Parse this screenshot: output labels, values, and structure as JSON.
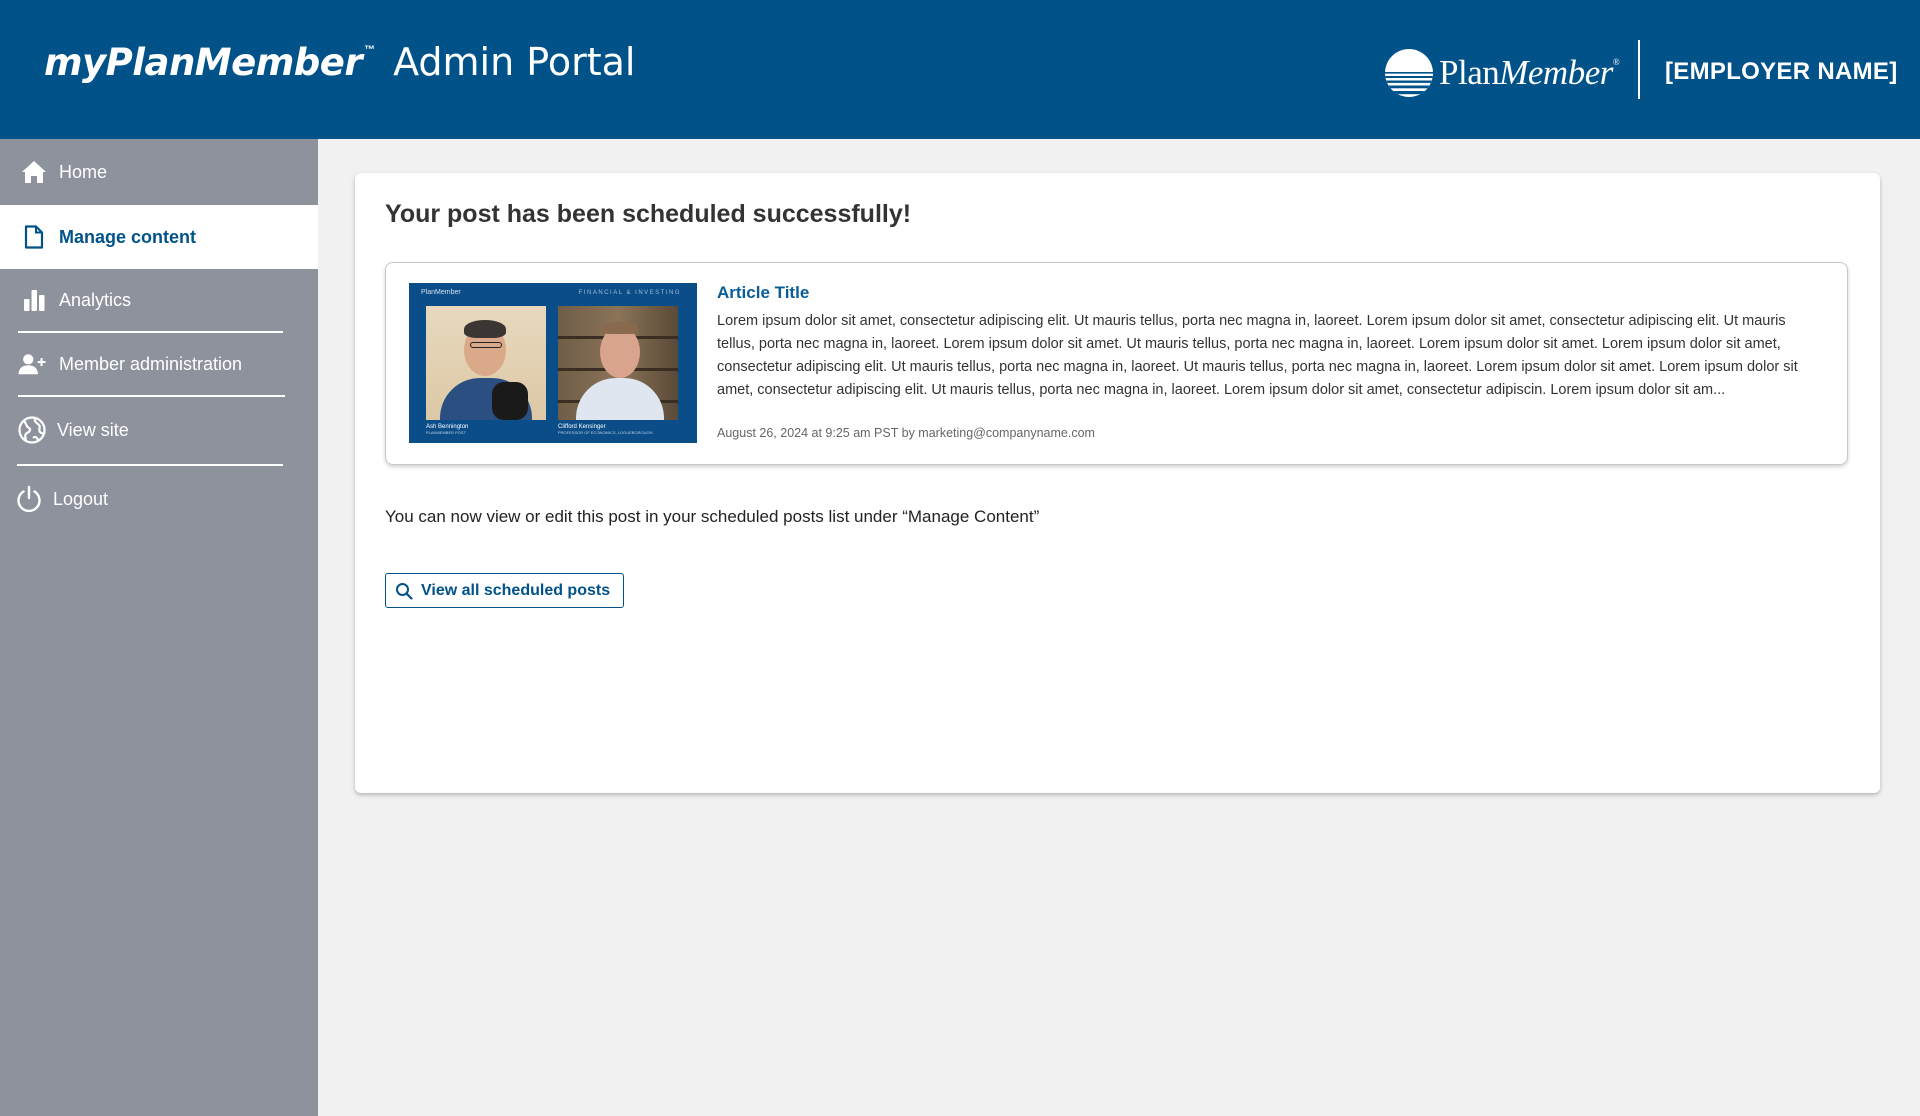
{
  "header": {
    "app_name": "myPlanMember",
    "trademark": "™",
    "portal_name": "Admin Portal",
    "logo_text_plan": "Plan",
    "logo_text_member": "Member",
    "logo_registered": "®",
    "employer_name": "[EMPLOYER NAME]"
  },
  "sidebar": {
    "items": [
      {
        "label": "Home",
        "icon": "home-icon"
      },
      {
        "label": "Manage content",
        "icon": "document-icon",
        "active": true
      },
      {
        "label": "Analytics",
        "icon": "bar-chart-icon"
      },
      {
        "label": "Member administration",
        "icon": "add-user-icon"
      },
      {
        "label": "View site",
        "icon": "globe-icon"
      },
      {
        "label": "Logout",
        "icon": "power-icon"
      }
    ]
  },
  "main": {
    "success_title": "Your post has been scheduled successfully!",
    "article": {
      "thumbnail_brand": "PlanMember",
      "thumbnail_tag": "FINANCIAL & INVESTING",
      "thumbnail_person_left": "Ash Bennington",
      "thumbnail_person_left_sub": "PLANMEMBER POST",
      "thumbnail_person_right": "Clifford Kensinger",
      "thumbnail_person_right_sub": "PROFESSOR OF ECONOMICS, LOGUEBOROUGH",
      "title": "Article Title",
      "body": "Lorem ipsum dolor sit amet, consectetur adipiscing elit. Ut mauris tellus, porta nec magna in, laoreet. Lorem ipsum dolor sit amet, consectetur adipiscing elit. Ut mauris tellus, porta nec magna in, laoreet. Lorem ipsum dolor sit amet. Ut mauris tellus, porta nec magna in, laoreet. Lorem ipsum dolor sit amet. Lorem ipsum dolor sit amet, consectetur adipiscing elit. Ut mauris tellus, porta nec magna in, laoreet. Ut mauris tellus, porta nec magna in, laoreet. Lorem ipsum dolor sit amet. Lorem ipsum dolor sit amet, consectetur adipiscing elit. Ut mauris tellus, porta nec magna in, laoreet. Lorem ipsum dolor sit amet, consectetur adipiscin.  Lorem ipsum dolor sit am...",
      "meta": "August 26, 2024 at 9:25 am PST by marketing@companyname.com"
    },
    "info_text": "You can now view or edit this post in your scheduled posts list under “Manage Content”",
    "view_button_label": "View all scheduled posts"
  },
  "colors": {
    "brand_blue": "#02528a",
    "sidebar_gray": "#8e929d",
    "page_background": "#f1f1f1",
    "link_blue": "#0a5c97"
  }
}
